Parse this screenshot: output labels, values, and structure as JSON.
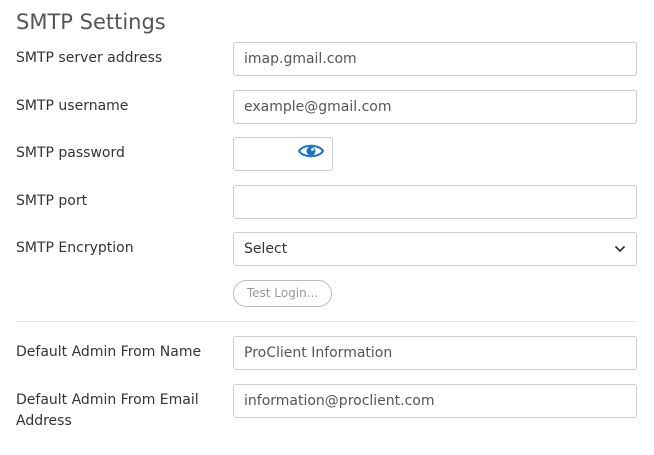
{
  "title": "SMTP Settings",
  "fields": {
    "server": {
      "label": "SMTP server address",
      "value": "imap.gmail.com"
    },
    "username": {
      "label": "SMTP username",
      "value": "example@gmail.com"
    },
    "password": {
      "label": "SMTP password",
      "value": ""
    },
    "port": {
      "label": "SMTP port",
      "value": ""
    },
    "encryption": {
      "label": "SMTP Encryption",
      "selected": "Select"
    },
    "from_name": {
      "label": "Default Admin From Name",
      "value": "ProClient Information"
    },
    "from_email": {
      "label_line1": "Default Admin From Email",
      "label_line2": "Address",
      "value": "information@proclient.com"
    }
  },
  "test_button": "Test Login...",
  "colors": {
    "accent": "#1a73c9",
    "border": "#cccccc"
  },
  "icons": {
    "password_toggle": "eye-icon",
    "select_arrow": "chevron-down-icon"
  }
}
